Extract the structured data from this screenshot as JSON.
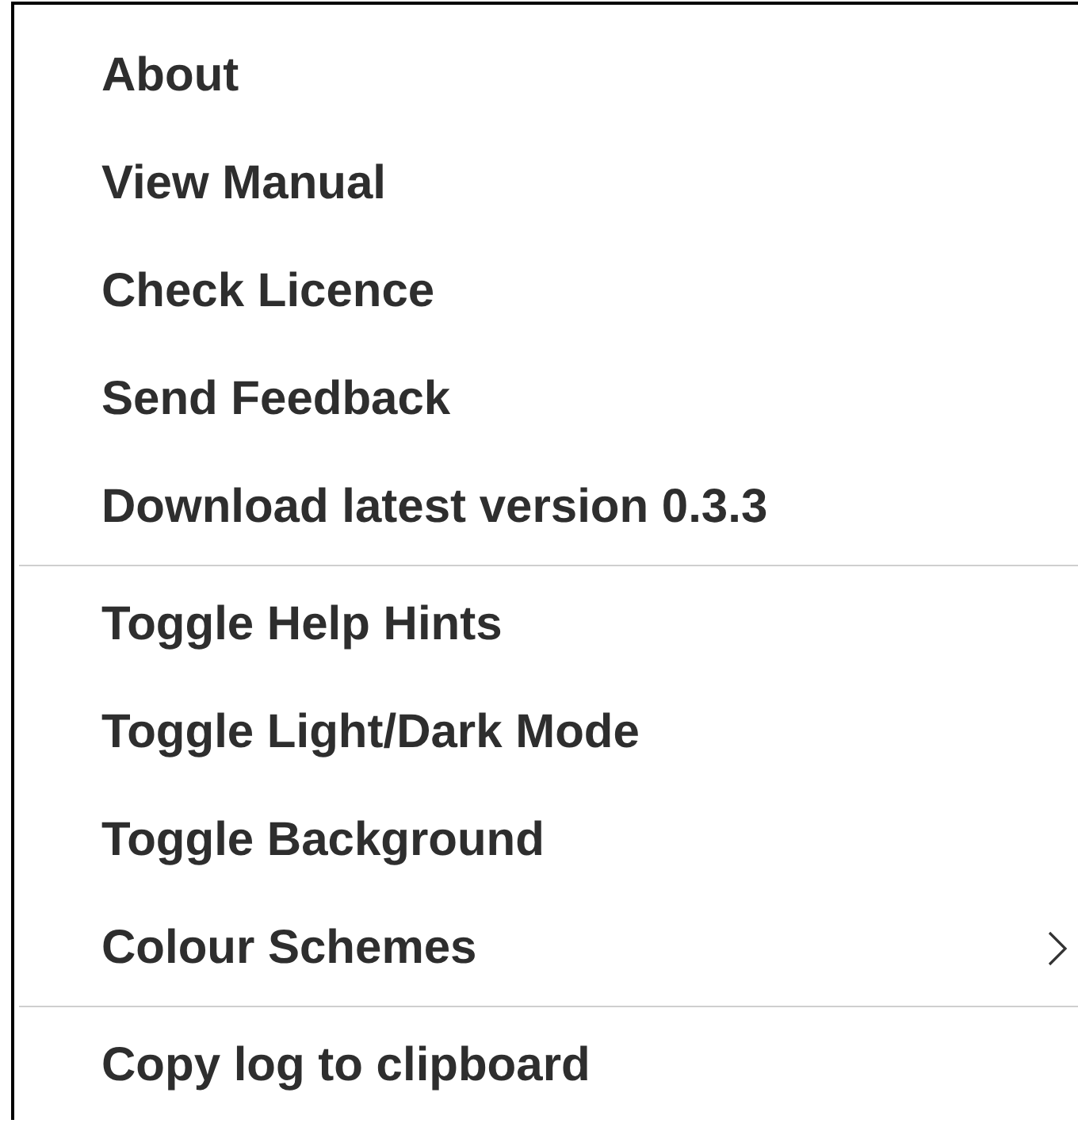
{
  "menu": {
    "sections": [
      {
        "items": [
          {
            "label": "About",
            "submenu": false
          },
          {
            "label": "View Manual",
            "submenu": false
          },
          {
            "label": "Check Licence",
            "submenu": false
          },
          {
            "label": "Send Feedback",
            "submenu": false
          },
          {
            "label": "Download latest version 0.3.3",
            "submenu": false
          }
        ]
      },
      {
        "items": [
          {
            "label": "Toggle Help Hints",
            "submenu": false
          },
          {
            "label": "Toggle Light/Dark Mode",
            "submenu": false
          },
          {
            "label": "Toggle Background",
            "submenu": false
          },
          {
            "label": "Colour Schemes",
            "submenu": true
          }
        ]
      },
      {
        "items": [
          {
            "label": "Copy log to clipboard",
            "submenu": false
          }
        ]
      }
    ]
  }
}
